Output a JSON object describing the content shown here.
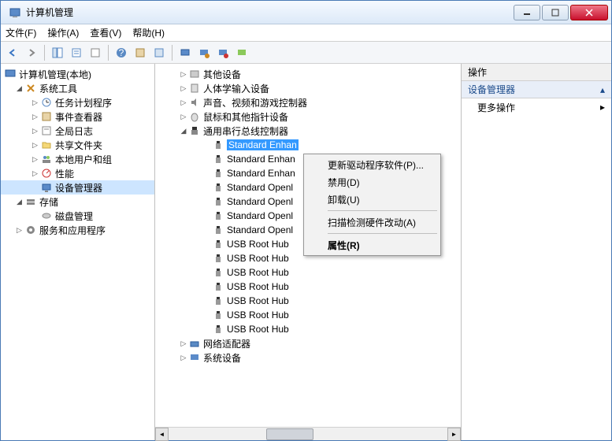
{
  "window": {
    "title": "计算机管理"
  },
  "menu": {
    "file": "文件(F)",
    "action": "操作(A)",
    "view": "查看(V)",
    "help": "帮助(H)"
  },
  "left_tree": {
    "root": "计算机管理(本地)",
    "system_tools": "系统工具",
    "task_scheduler": "任务计划程序",
    "event_viewer": "事件查看器",
    "global_log": "全局日志",
    "shared_folders": "共享文件夹",
    "local_users": "本地用户和组",
    "performance": "性能",
    "device_manager": "设备管理器",
    "storage": "存储",
    "disk_mgmt": "磁盘管理",
    "services_apps": "服务和应用程序"
  },
  "mid_tree": {
    "other_devices": "其他设备",
    "hid": "人体学输入设备",
    "sound": "声音、视频和游戏控制器",
    "mouse": "鼠标和其他指针设备",
    "usb_controllers": "通用串行总线控制器",
    "items": [
      "Standard Enhan",
      "Standard Enhan",
      "Standard Enhan",
      "Standard Openl",
      "Standard Openl",
      "Standard Openl",
      "Standard Openl",
      "USB Root Hub",
      "USB Root Hub",
      "USB Root Hub",
      "USB Root Hub",
      "USB Root Hub",
      "USB Root Hub",
      "USB Root Hub"
    ],
    "network_adapters": "网络适配器",
    "system_devices": "系统设备"
  },
  "right_pane": {
    "header": "操作",
    "section": "设备管理器",
    "more": "更多操作"
  },
  "context_menu": {
    "update": "更新驱动程序软件(P)...",
    "disable": "禁用(D)",
    "uninstall": "卸载(U)",
    "scan": "扫描检测硬件改动(A)",
    "properties": "属性(R)"
  }
}
